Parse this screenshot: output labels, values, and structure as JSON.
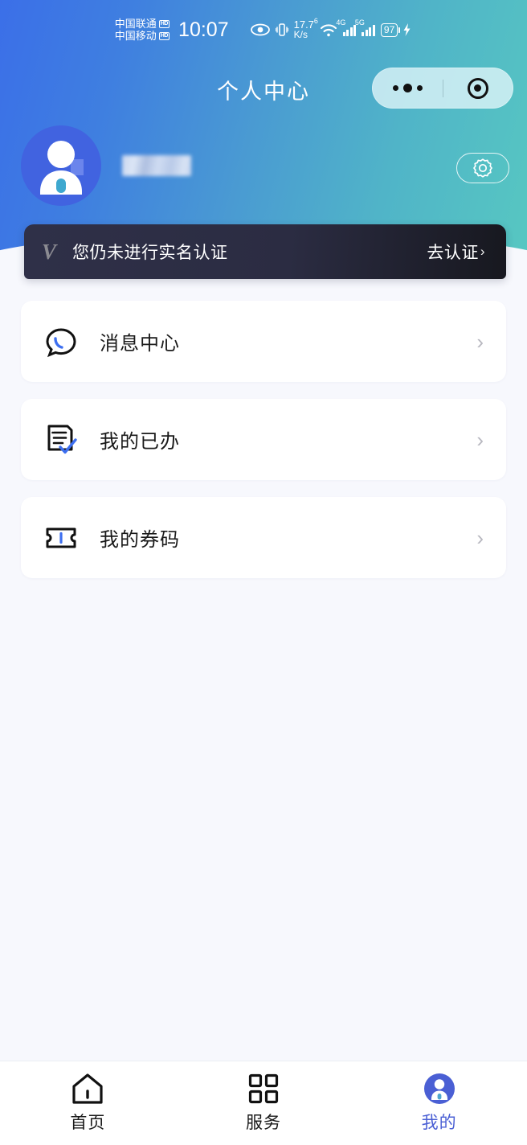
{
  "status_bar": {
    "carriers": [
      {
        "name": "中国联通",
        "tech": "HD"
      },
      {
        "name": "中国移动",
        "tech": "HD"
      }
    ],
    "time": "10:07",
    "eye_icon": "eye-icon",
    "vibrate_icon": "vibrate-icon",
    "net_speed_value": "17.7",
    "net_speed_unit": "K/s",
    "wifi_generation": "6",
    "wifi_icon": "wifi-icon",
    "signal1_label": "4G",
    "signal2_label": "5G",
    "battery_percent": "97",
    "charging_icon": "charging-bolt-icon"
  },
  "nav": {
    "title": "个人中心",
    "capsule": {
      "menu_icon": "more-dots-icon",
      "target_icon": "target-circle-icon"
    }
  },
  "profile": {
    "avatar_icon": "user-avatar-icon",
    "username": "",
    "settings_icon": "gear-icon"
  },
  "verify_banner": {
    "badge": "V",
    "message": "您仍未进行实名认证",
    "action_label": "去认证",
    "action_chevron": "›"
  },
  "menu": {
    "items": [
      {
        "icon": "message-bubble-icon",
        "label": "消息中心",
        "chevron": "›"
      },
      {
        "icon": "document-check-icon",
        "label": "我的已办",
        "chevron": "›"
      },
      {
        "icon": "ticket-icon",
        "label": "我的券码",
        "chevron": "›"
      }
    ]
  },
  "tabbar": {
    "items": [
      {
        "icon": "home-icon",
        "label": "首页",
        "active": false
      },
      {
        "icon": "grid-services-icon",
        "label": "服务",
        "active": false
      },
      {
        "icon": "user-profile-icon",
        "label": "我的",
        "active": true
      }
    ]
  },
  "colors": {
    "gradient_start": "#3b6fe8",
    "gradient_end": "#57c8c1",
    "page_background": "#f7f8fd",
    "accent_blue": "#4a5fd4",
    "banner_dark": "#2b2c42",
    "card_white": "#ffffff"
  }
}
